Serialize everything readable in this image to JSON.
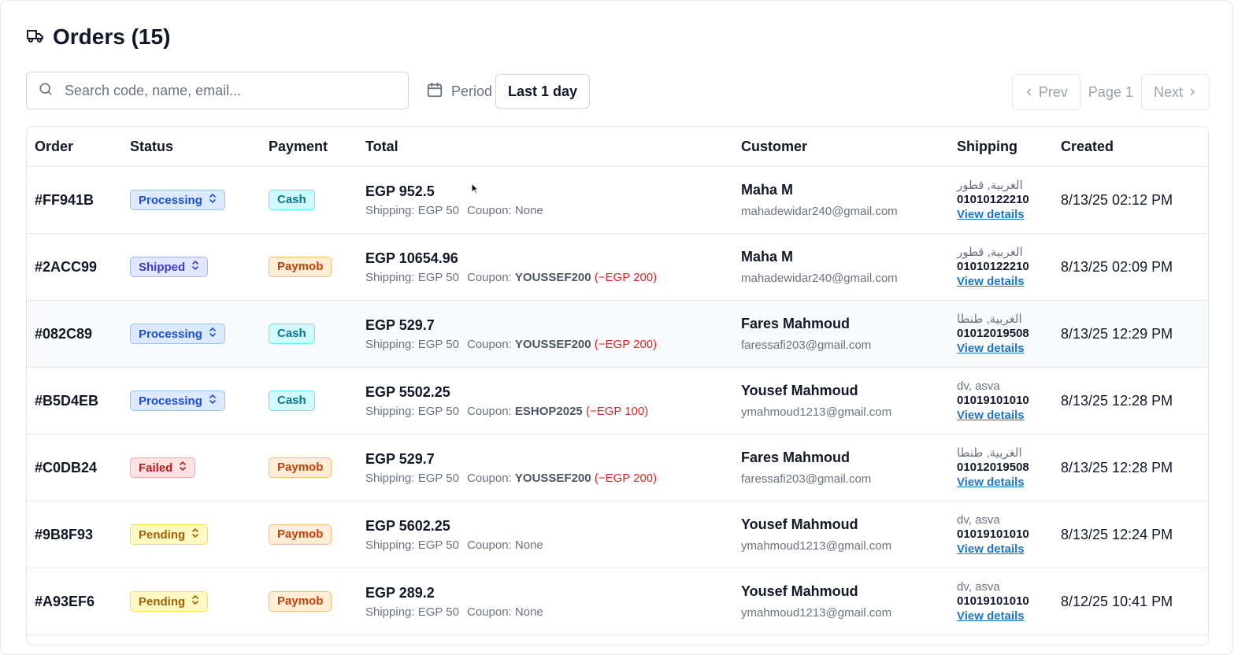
{
  "header": {
    "title": "Orders (15)"
  },
  "search": {
    "placeholder": "Search code, name, email..."
  },
  "period": {
    "label": "Period",
    "value": "Last 1 day"
  },
  "pagination": {
    "prev": "Prev",
    "page": "Page 1",
    "next": "Next"
  },
  "columns": [
    "Order",
    "Status",
    "Payment",
    "Total",
    "Customer",
    "Shipping",
    "Created"
  ],
  "labels": {
    "shipping": "Shipping:",
    "coupon": "Coupon:",
    "view_details": "View details"
  },
  "orders": [
    {
      "code": "#FF941B",
      "status": "Processing",
      "status_kind": "processing",
      "payment": "Cash",
      "payment_kind": "cash",
      "total": "EGP 952.5",
      "shipping": "EGP 50",
      "coupon": "None",
      "discount": "",
      "customer": "Maha M",
      "email": "mahadewidar240@gmail.com",
      "address": "الغربية, قطور",
      "phone": "01010122210",
      "created": "8/13/25 02:12 PM"
    },
    {
      "code": "#2ACC99",
      "status": "Shipped",
      "status_kind": "shipped",
      "payment": "Paymob",
      "payment_kind": "paymob",
      "total": "EGP 10654.96",
      "shipping": "EGP 50",
      "coupon": "YOUSSEF200",
      "discount": "(−EGP 200)",
      "customer": "Maha M",
      "email": "mahadewidar240@gmail.com",
      "address": "الغربية, قطور",
      "phone": "01010122210",
      "created": "8/13/25 02:09 PM"
    },
    {
      "code": "#082C89",
      "status": "Processing",
      "status_kind": "processing",
      "payment": "Cash",
      "payment_kind": "cash",
      "total": "EGP 529.7",
      "shipping": "EGP 50",
      "coupon": "YOUSSEF200",
      "discount": "(−EGP 200)",
      "customer": "Fares Mahmoud",
      "email": "faressafi203@gmail.com",
      "address": "الغربية, طنطا",
      "phone": "01012019508",
      "created": "8/13/25 12:29 PM"
    },
    {
      "code": "#B5D4EB",
      "status": "Processing",
      "status_kind": "processing",
      "payment": "Cash",
      "payment_kind": "cash",
      "total": "EGP 5502.25",
      "shipping": "EGP 50",
      "coupon": "ESHOP2025",
      "discount": "(−EGP 100)",
      "customer": "Yousef Mahmoud",
      "email": "ymahmoud1213@gmail.com",
      "address": "dv, asva",
      "phone": "01019101010",
      "created": "8/13/25 12:28 PM"
    },
    {
      "code": "#C0DB24",
      "status": "Failed",
      "status_kind": "failed",
      "payment": "Paymob",
      "payment_kind": "paymob",
      "total": "EGP 529.7",
      "shipping": "EGP 50",
      "coupon": "YOUSSEF200",
      "discount": "(−EGP 200)",
      "customer": "Fares Mahmoud",
      "email": "faressafi203@gmail.com",
      "address": "الغربية, طنطا",
      "phone": "01012019508",
      "created": "8/13/25 12:28 PM"
    },
    {
      "code": "#9B8F93",
      "status": "Pending",
      "status_kind": "pending",
      "payment": "Paymob",
      "payment_kind": "paymob",
      "total": "EGP 5602.25",
      "shipping": "EGP 50",
      "coupon": "None",
      "discount": "",
      "customer": "Yousef Mahmoud",
      "email": "ymahmoud1213@gmail.com",
      "address": "dv, asva",
      "phone": "01019101010",
      "created": "8/13/25 12:24 PM"
    },
    {
      "code": "#A93EF6",
      "status": "Pending",
      "status_kind": "pending",
      "payment": "Paymob",
      "payment_kind": "paymob",
      "total": "EGP 289.2",
      "shipping": "EGP 50",
      "coupon": "None",
      "discount": "",
      "customer": "Yousef Mahmoud",
      "email": "ymahmoud1213@gmail.com",
      "address": "dv, asva",
      "phone": "01019101010",
      "created": "8/12/25 10:41 PM"
    }
  ]
}
